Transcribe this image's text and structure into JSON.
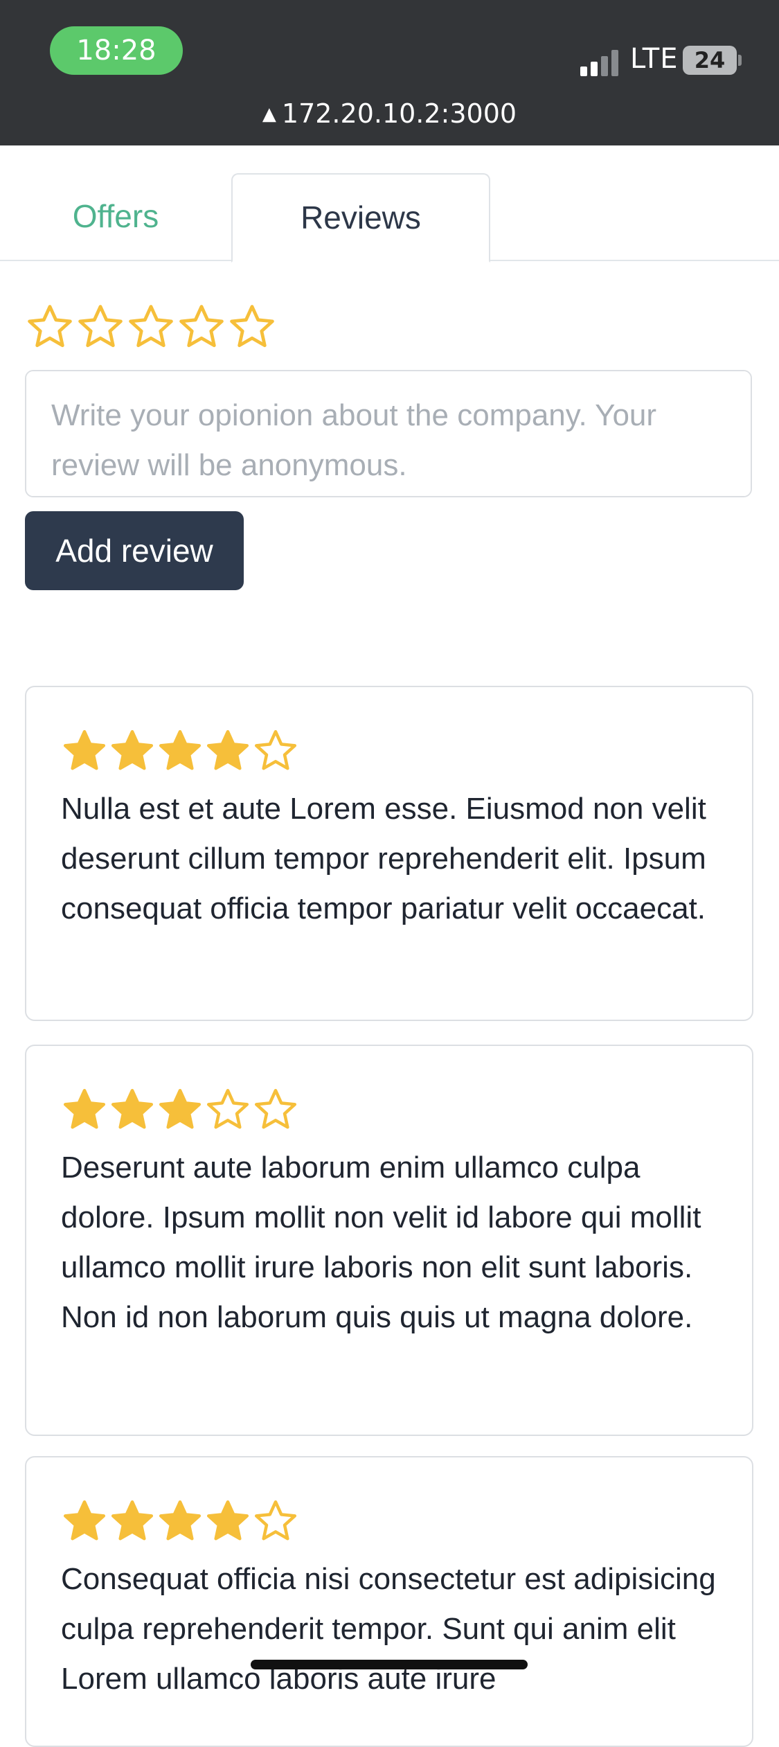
{
  "status_bar": {
    "time": "18:28",
    "network": "LTE",
    "battery": "24",
    "url": "172.20.10.2:3000",
    "warning_glyph": "▲"
  },
  "tabs": [
    {
      "label": "Offers",
      "active": false
    },
    {
      "label": "Reviews",
      "active": true
    }
  ],
  "review_form": {
    "rating": 0,
    "max_rating": 5,
    "placeholder": "Write your opionion about the company. Your review will be anonymous.",
    "value": "",
    "submit_label": "Add review"
  },
  "reviews": [
    {
      "rating": 4,
      "text": "Nulla est et aute Lorem esse. Eiusmod non velit deserunt cillum tempor reprehenderit elit. Ipsum consequat officia tempor pariatur velit occaecat."
    },
    {
      "rating": 3,
      "text": "Deserunt aute laborum enim ullamco culpa dolore. Ipsum mollit non velit id labore qui mollit ullamco mollit irure laboris non elit sunt laboris. Non id non laborum quis quis ut magna dolore."
    },
    {
      "rating": 4,
      "text": "Consequat officia nisi consectetur est adipisicing culpa reprehenderit tempor. Sunt qui anim elit Lorem ullamco laboris aute irure"
    }
  ],
  "colors": {
    "star": "#f6bf3a",
    "accent_green": "#4fb38e",
    "button_dark": "#2e3a4d",
    "status_bar": "#333538"
  },
  "icons": {
    "star_filled": "star-filled-icon",
    "star_empty": "star-outline-icon",
    "signal": "cellular-signal-icon",
    "battery": "battery-icon",
    "warning": "warning-triangle-icon"
  }
}
